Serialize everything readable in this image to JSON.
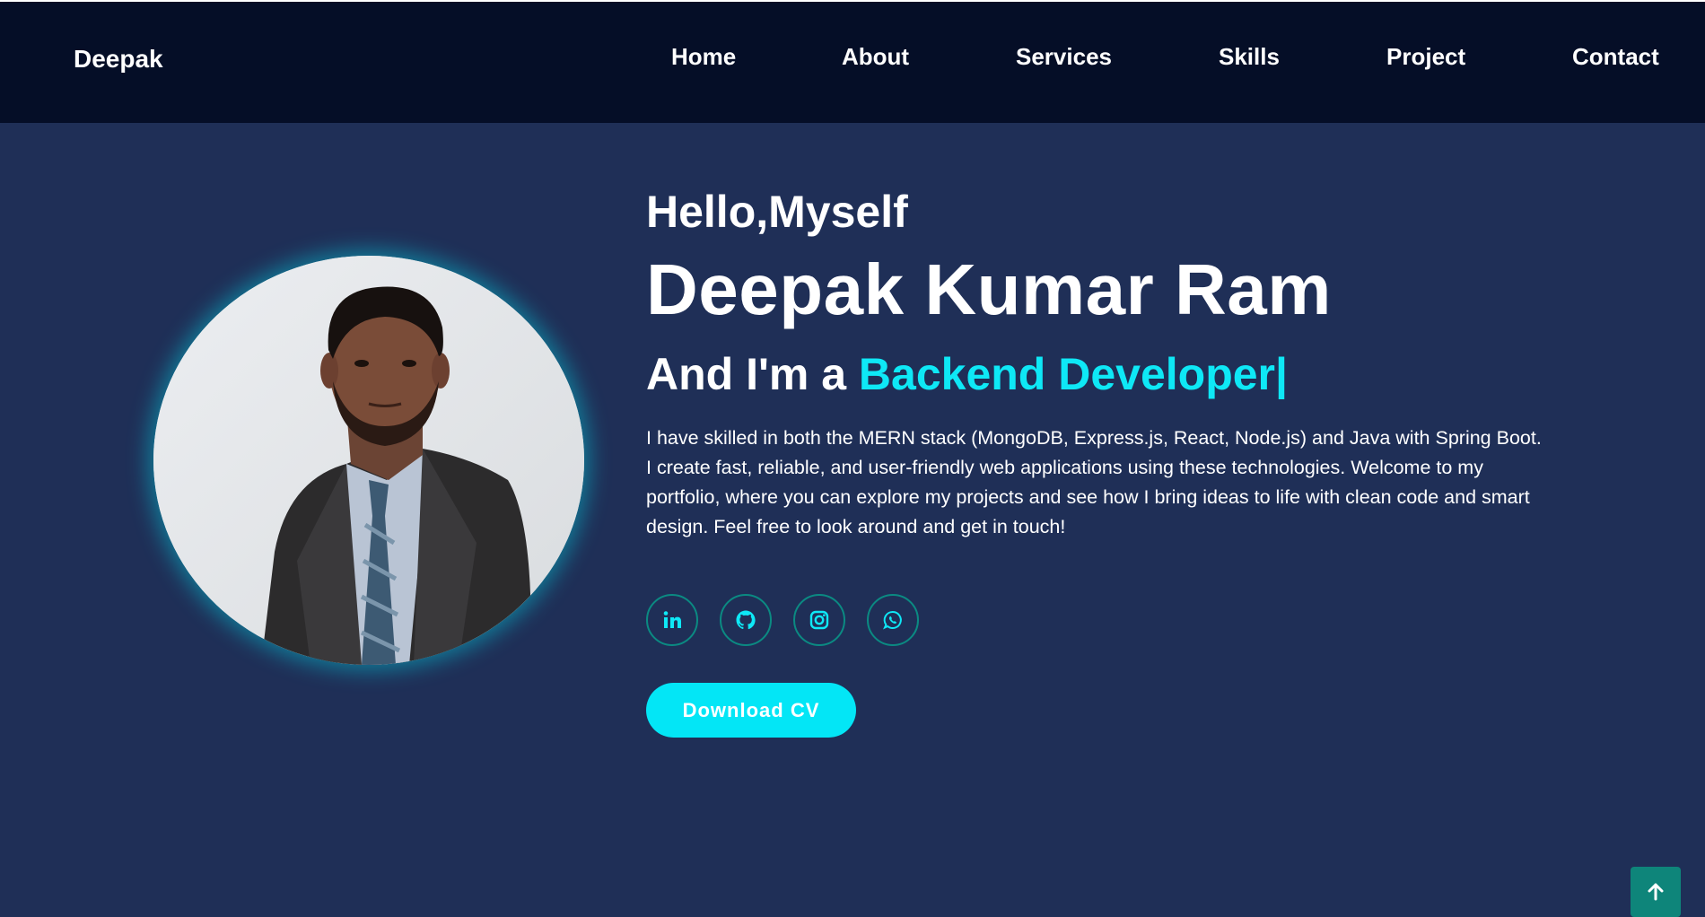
{
  "header": {
    "brand": "Deepak",
    "nav": [
      "Home",
      "About",
      "Services",
      "Skills",
      "Project",
      "Contact"
    ]
  },
  "hero": {
    "greeting": "Hello,Myself",
    "name": "Deepak Kumar Ram",
    "role_prefix": "And I'm a ",
    "role_highlight": "Backend Developer|",
    "bio": "I have skilled in both the MERN stack (MongoDB, Express.js, React, Node.js) and Java with Spring Boot. I create fast, reliable, and user-friendly web applications using these technologies. Welcome to my portfolio, where you can explore my projects and see how I bring ideas to life with clean code and smart design. Feel free to look around and get in touch!",
    "socials": [
      "linkedin-icon",
      "github-icon",
      "instagram-icon",
      "whatsapp-icon"
    ],
    "cta_label": "Download CV"
  },
  "colors": {
    "header_bg": "#050e27",
    "page_bg": "#1f2f57",
    "accent": "#0ee8f6",
    "button_bg": "#03e6f6",
    "scroll_top_bg": "#0e857a",
    "social_border": "#0b8a82"
  },
  "scroll_top_icon": "arrow-up-icon"
}
